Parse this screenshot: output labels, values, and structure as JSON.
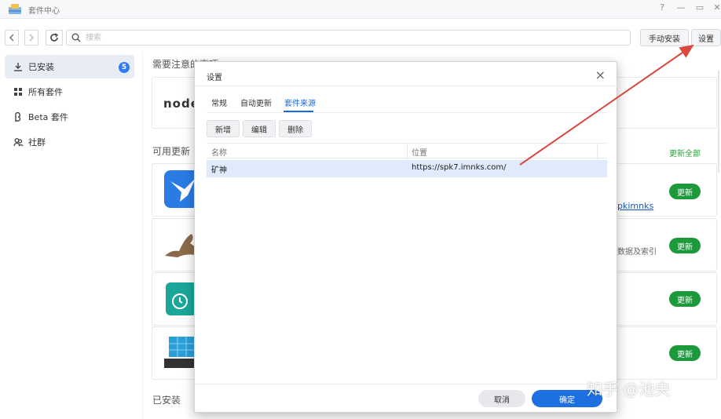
{
  "window": {
    "title": "套件中心",
    "controls": [
      "?",
      "—",
      "▭",
      "✕"
    ]
  },
  "toolbar": {
    "search_placeholder": "搜索",
    "manual_install": "手动安装",
    "settings": "设置"
  },
  "sidebar": {
    "items": [
      {
        "label": "已安装",
        "icon": "download-icon",
        "badge": "5",
        "active": true
      },
      {
        "label": "所有套件",
        "icon": "grid-icon",
        "active": false
      },
      {
        "label": "Beta 套件",
        "icon": "beta-icon",
        "active": false
      },
      {
        "label": "社群",
        "icon": "community-icon",
        "active": false
      }
    ]
  },
  "main": {
    "attention_title": "需要注意的事项",
    "node_logo": "node",
    "updates_title": "可用更新",
    "update_all": "更新全部",
    "link_fragment": "pkimnks",
    "desc_fragment": "数据及索引",
    "update_label": "更新",
    "installed_title": "已安装"
  },
  "modal": {
    "title": "设置",
    "close": "×",
    "tabs": [
      "常规",
      "自动更新",
      "套件来源"
    ],
    "active_tab": 2,
    "buttons": {
      "add": "新增",
      "edit": "编辑",
      "delete": "删除"
    },
    "columns": {
      "name": "名称",
      "location": "位置"
    },
    "rows": [
      {
        "name": "矿神",
        "location": "https://spk7.imnks.com/"
      }
    ],
    "cancel": "取消",
    "ok": "确定"
  },
  "overlay": {
    "watermark": "知乎 @池央",
    "arrow_color": "#d9473f"
  },
  "colors": {
    "accent": "#1a6ae0",
    "badge": "#2f7cf6",
    "update_green": "#1c9a3b",
    "selection": "#dfeafb"
  }
}
